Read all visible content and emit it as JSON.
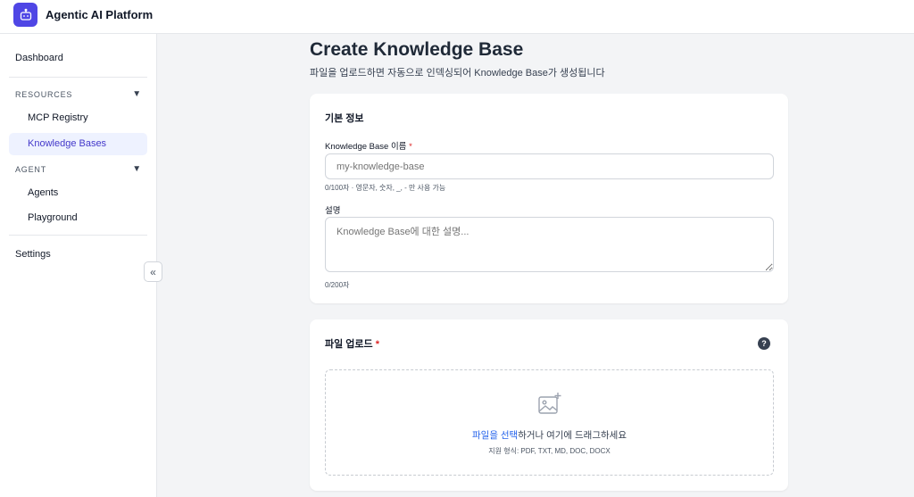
{
  "app": {
    "title": "Agentic AI Platform"
  },
  "sidebar": {
    "dashboard": "Dashboard",
    "sections": [
      {
        "heading": "RESOURCES",
        "items": [
          "MCP Registry",
          "Knowledge Bases"
        ]
      },
      {
        "heading": "AGENT",
        "items": [
          "Agents",
          "Playground"
        ]
      }
    ],
    "settings": "Settings",
    "active_item": "Knowledge Bases",
    "collapse_glyph": "«"
  },
  "page": {
    "title": "Create Knowledge Base",
    "subtitle": "파일을 업로드하면 자동으로 인덱싱되어 Knowledge Base가 생성됩니다"
  },
  "basic_info": {
    "title": "기본 정보",
    "name_label": "Knowledge Base 이름",
    "name_placeholder": "my-knowledge-base",
    "name_value": "",
    "name_hint": "0/100자 · 영문자, 숫자, _, - 만 사용 가능",
    "desc_label": "설명",
    "desc_placeholder": "Knowledge Base에 대한 설명...",
    "desc_value": "",
    "desc_hint": "0/200자"
  },
  "file_upload": {
    "title": "파일 업로드",
    "help": "?",
    "select_link": "파일을 선택",
    "drop_text": "하거나 여기에 드래그하세요",
    "formats": "지원 형식: PDF, TXT, MD, DOC, DOCX"
  },
  "required_mark": "*",
  "colors": {
    "accent": "#4f46e5",
    "active_bg": "#eef2ff",
    "link": "#2563eb",
    "required": "#dc2626"
  }
}
